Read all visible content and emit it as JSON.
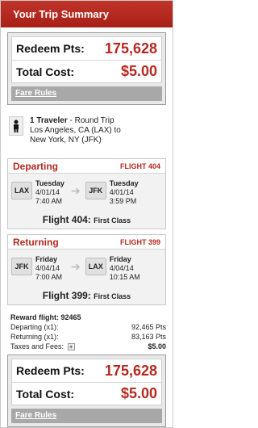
{
  "header": {
    "title": "Your Trip Summary"
  },
  "summary": {
    "redeem_label": "Redeem Pts:",
    "redeem_value": "175,628",
    "total_label": "Total Cost:",
    "total_value": "$5.00",
    "fare_rules": "Fare Rules"
  },
  "traveler": {
    "count_label": "1 Traveler",
    "trip_type": "- Round Trip",
    "line2": "Los Angeles, CA (LAX) to",
    "line3": "New York, NY (JFK)",
    "icon": "person-icon"
  },
  "departing": {
    "title": "Departing",
    "flight_label": "FLIGHT 404",
    "from_code": "LAX",
    "from_day": "Tuesday",
    "from_date": "4/01/14",
    "from_time": "7:40 AM",
    "to_code": "JFK",
    "to_day": "Tuesday",
    "to_date": "4/01/14",
    "to_time": "3:59 PM",
    "summary": "Flight 404:",
    "cabin": "First Class"
  },
  "returning": {
    "title": "Returning",
    "flight_label": "FLIGHT 399",
    "from_code": "JFK",
    "from_day": "Friday",
    "from_date": "4/04/14",
    "from_time": "7:00 AM",
    "to_code": "LAX",
    "to_day": "Friday",
    "to_date": "4/04/14",
    "to_time": "10:15 AM",
    "summary": "Flight 399:",
    "cabin": "First Class"
  },
  "reward": {
    "title": "Reward flight: 92465",
    "departing_label": "Departing (x1):",
    "departing_value": "92,465 Pts",
    "returning_label": "Returning (x1):",
    "returning_value": "83,163 Pts",
    "taxes_label": "Taxes and Fees:",
    "taxes_value": "$5.00"
  },
  "summary_bottom": {
    "redeem_label": "Redeem Pts:",
    "redeem_value": "175,628",
    "total_label": "Total Cost:",
    "total_value": "$5.00",
    "fare_rules": "Fare Rules"
  }
}
